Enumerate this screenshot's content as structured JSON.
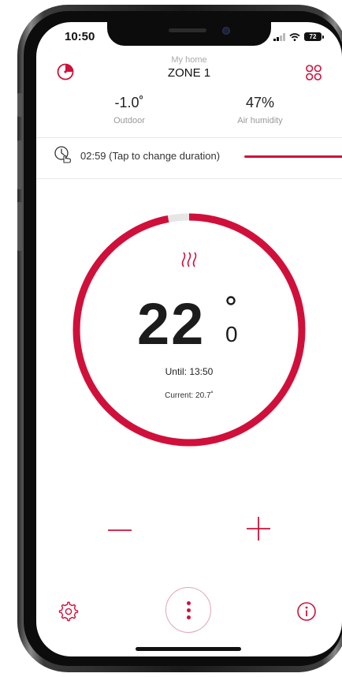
{
  "status_bar": {
    "time": "10:50",
    "battery": "72"
  },
  "header": {
    "subtitle": "My home",
    "title": "ZONE 1"
  },
  "stats": {
    "outdoor": {
      "value": "-1.0˚",
      "label": "Outdoor"
    },
    "humidity": {
      "value": "47%",
      "label": "Air humidity"
    }
  },
  "timer": {
    "text": "02:59 (Tap to change duration)"
  },
  "thermostat": {
    "setpoint_main": "22",
    "setpoint_fraction": "0",
    "until": "Until: 13:50",
    "current": "Current: 20.7˚",
    "progress_fraction": 0.97
  },
  "colors": {
    "accent": "#d0103a",
    "track": "#e6e6e6"
  },
  "icons": [
    "timer-icon",
    "zones-grid-icon",
    "clock-hand-icon",
    "heat-icon",
    "minus-icon",
    "plus-icon",
    "gear-icon",
    "more-vertical-icon",
    "info-icon"
  ]
}
